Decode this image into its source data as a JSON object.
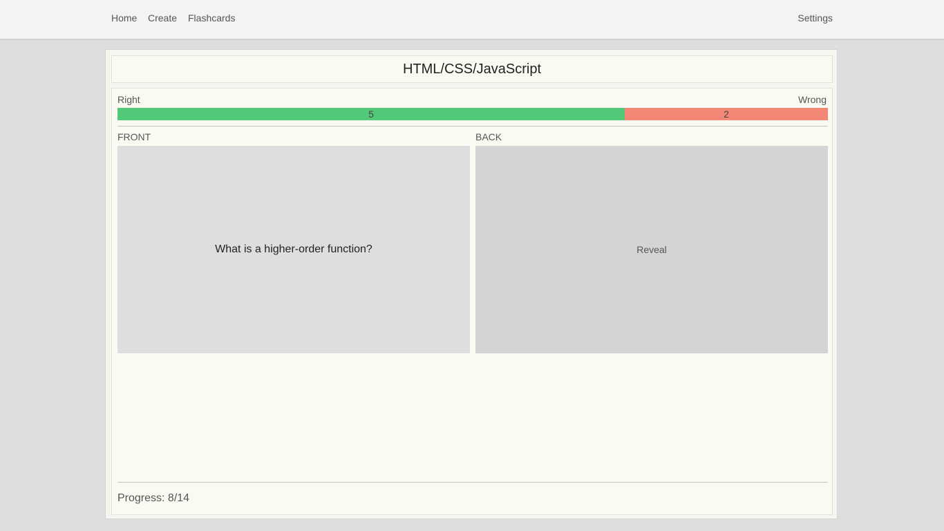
{
  "nav": {
    "home": "Home",
    "create": "Create",
    "flashcards": "Flashcards",
    "settings": "Settings"
  },
  "deck": {
    "title": "HTML/CSS/JavaScript"
  },
  "score": {
    "right_label": "Right",
    "wrong_label": "Wrong",
    "right_count": "5",
    "wrong_count": "2",
    "right_fraction": 0.714,
    "wrong_fraction": 0.286
  },
  "card": {
    "front_label": "FRONT",
    "back_label": "BACK",
    "front_text": "What is a higher-order function?",
    "back_button": "Reveal"
  },
  "progress": {
    "text": "Progress: 8/14"
  },
  "colors": {
    "right": "#52c978",
    "wrong": "#f48776"
  }
}
